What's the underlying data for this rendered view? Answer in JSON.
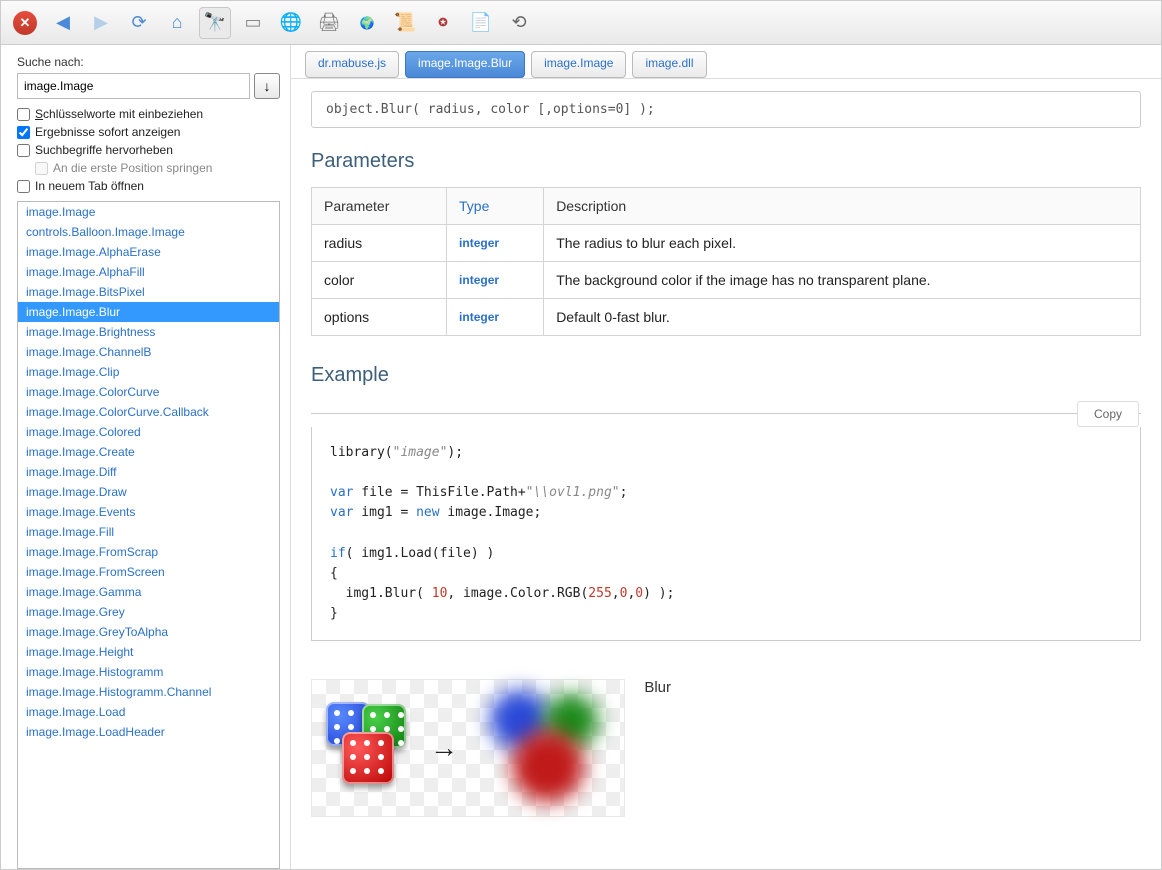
{
  "toolbar": {
    "icons": [
      "close-icon",
      "back-icon",
      "forward-icon",
      "refresh-icon",
      "home-icon",
      "binoculars-icon",
      "new-tab-icon",
      "home-globe-icon",
      "print-icon",
      "globe-small-icon",
      "doc-badge-icon",
      "sample-stamp-icon",
      "page-icon",
      "sync-icon"
    ]
  },
  "search": {
    "label": "Suche nach:",
    "value": "image.Image",
    "go": "↓",
    "opts": {
      "keywords": "Schlüsselworte mit einbeziehen",
      "instant": "Ergebnisse sofort anzeigen",
      "highlight": "Suchbegriffe hervorheben",
      "jumpfirst": "An die erste Position springen",
      "newtab": "In neuem Tab öffnen"
    },
    "checked": {
      "keywords": false,
      "instant": true,
      "highlight": false,
      "jumpfirst": false,
      "newtab": false
    }
  },
  "results": [
    "image.Image",
    "controls.Balloon.Image.Image",
    "image.Image.AlphaErase",
    "image.Image.AlphaFill",
    "image.Image.BitsPixel",
    "image.Image.Blur",
    "image.Image.Brightness",
    "image.Image.ChannelB",
    "image.Image.Clip",
    "image.Image.ColorCurve",
    "image.Image.ColorCurve.Callback",
    "image.Image.Colored",
    "image.Image.Create",
    "image.Image.Diff",
    "image.Image.Draw",
    "image.Image.Events",
    "image.Image.Fill",
    "image.Image.FromScrap",
    "image.Image.FromScreen",
    "image.Image.Gamma",
    "image.Image.Grey",
    "image.Image.GreyToAlpha",
    "image.Image.Height",
    "image.Image.Histogramm",
    "image.Image.Histogramm.Channel",
    "image.Image.Load",
    "image.Image.LoadHeader"
  ],
  "results_selected": 5,
  "tabs": [
    "dr.mabuse.js",
    "image.Image.Blur",
    "image.Image",
    "image.dll"
  ],
  "tabs_active": 1,
  "doc": {
    "syntax": "object.Blur( radius, color [,options=0] );",
    "sec_params": "Parameters",
    "sec_example": "Example",
    "th": {
      "p": "Parameter",
      "t": "Type",
      "d": "Description"
    },
    "rows": [
      {
        "p": "radius",
        "t": "integer",
        "d": "The radius to blur each pixel."
      },
      {
        "p": "color",
        "t": "integer",
        "d": "The background color if the image has no transparent plane."
      },
      {
        "p": "options",
        "t": "integer",
        "d": "Default 0-fast blur."
      }
    ],
    "copy": "Copy",
    "caption": "Blur",
    "code": {
      "l1a": "library(",
      "l1b": "\"image\"",
      "l1c": ");",
      "l2a": "var",
      "l2b": " file = ThisFile.Path+",
      "l2c": "\"\\\\ovl1.png\"",
      "l2d": ";",
      "l3a": "var",
      "l3b": " img1 = ",
      "l3c": "new",
      "l3d": " image.Image;",
      "l4a": "if",
      "l4b": "( img1.Load(file) )",
      "l5": "{",
      "l6a": "  img1.Blur( ",
      "l6b": "10",
      "l6c": ", image.Color.RGB(",
      "l6d": "255",
      "l6e": ",",
      "l6f": "0",
      "l6g": ",",
      "l6h": "0",
      "l6i": ") );",
      "l7": "}"
    }
  }
}
